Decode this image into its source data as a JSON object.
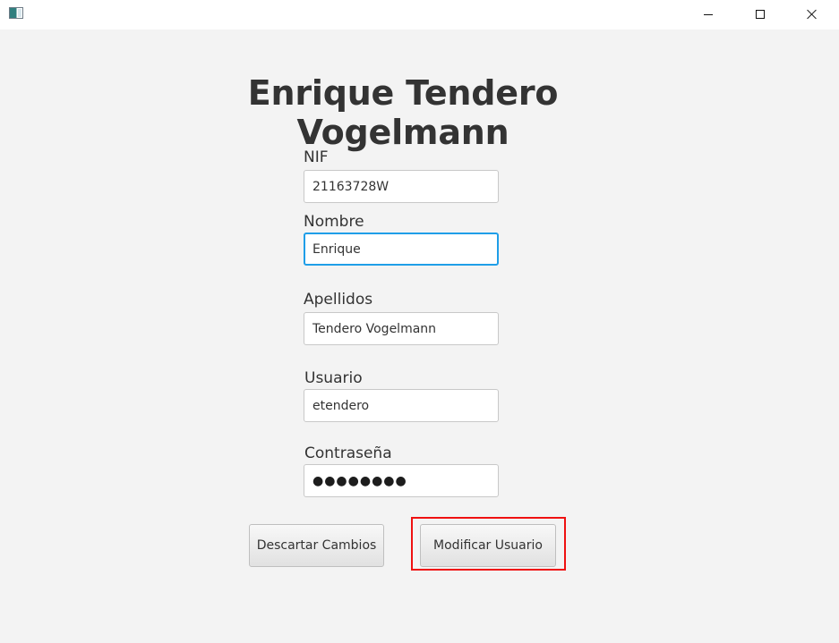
{
  "window": {
    "icon": "app-window-icon",
    "controls": {
      "minimize": "minimize-icon",
      "maximize": "maximize-icon",
      "close": "close-icon"
    }
  },
  "page": {
    "title": "Enrique Tendero Vogelmann"
  },
  "form": {
    "nif": {
      "label": "NIF",
      "value": "21163728W"
    },
    "nombre": {
      "label": "Nombre",
      "value": "Enrique"
    },
    "apellidos": {
      "label": "Apellidos",
      "value": "Tendero Vogelmann"
    },
    "usuario": {
      "label": "Usuario",
      "value": "etendero"
    },
    "contrasena": {
      "label": "Contraseña",
      "masked_value": "●●●●●●●●"
    }
  },
  "actions": {
    "discard_label": "Descartar Cambios",
    "modify_label": "Modificar Usuario"
  },
  "colors": {
    "focus_blue": "#1f9ee8",
    "highlight_red": "#ef1111",
    "background": "#f3f3f3"
  }
}
